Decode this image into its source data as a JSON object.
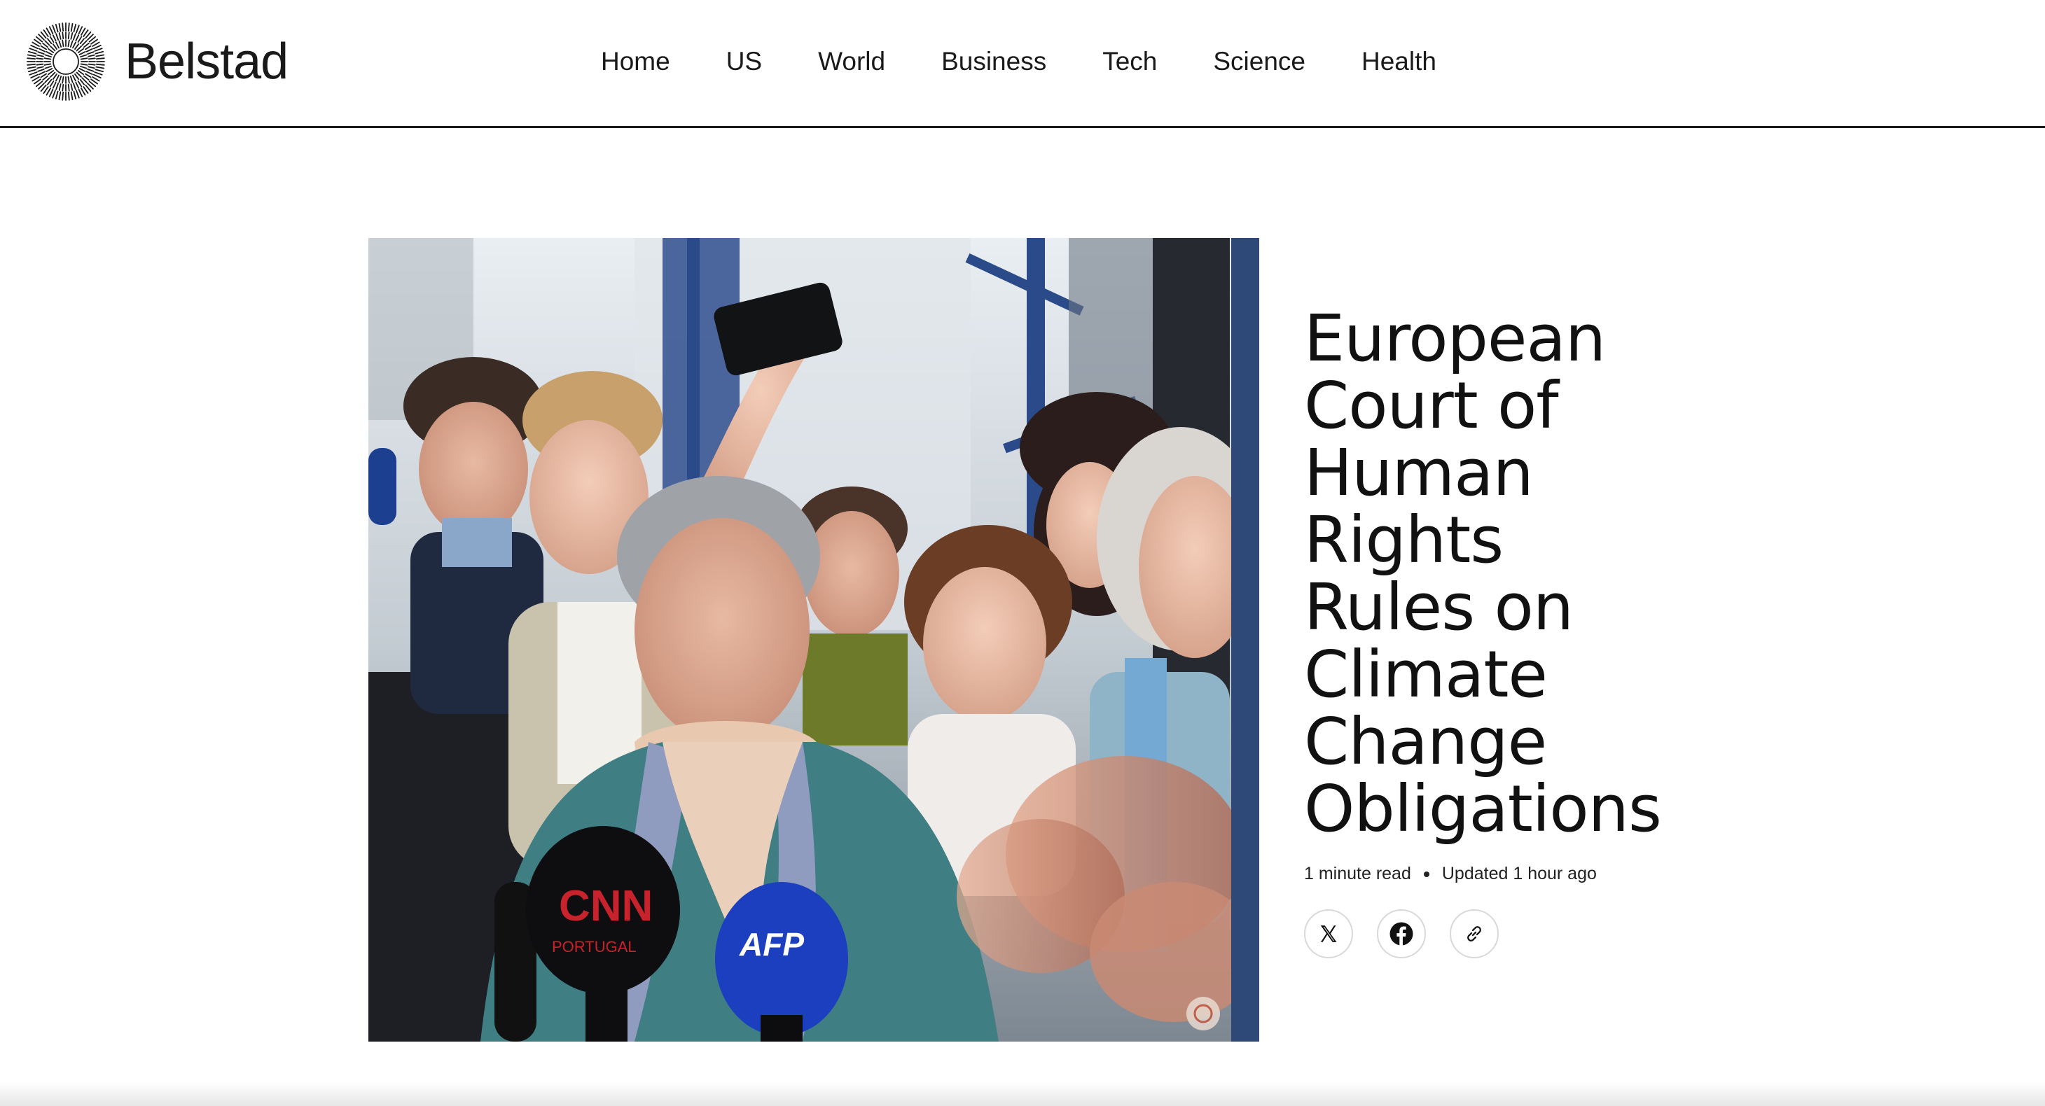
{
  "site": {
    "name": "Belstad",
    "logo_icon": "sunburst-logo-icon"
  },
  "nav": {
    "items": [
      {
        "label": "Home"
      },
      {
        "label": "US"
      },
      {
        "label": "World"
      },
      {
        "label": "Business"
      },
      {
        "label": "Tech"
      },
      {
        "label": "Science"
      },
      {
        "label": "Health"
      }
    ]
  },
  "article": {
    "headline_lines": [
      "European",
      "Court of",
      "Human",
      "Rights",
      "Rules on",
      "Climate",
      "Change",
      "Obligations"
    ],
    "read_time": "1 minute read",
    "updated": "Updated 1 hour ago",
    "image": {
      "mic_labels": [
        "CNN",
        "PORTUGAL",
        "AFP"
      ]
    },
    "share": [
      {
        "name": "x-icon"
      },
      {
        "name": "facebook-icon"
      },
      {
        "name": "link-icon"
      }
    ]
  },
  "colors": {
    "accent_bar": "#2e4877",
    "header_rule": "#1a1a1a",
    "text": "#111111"
  }
}
